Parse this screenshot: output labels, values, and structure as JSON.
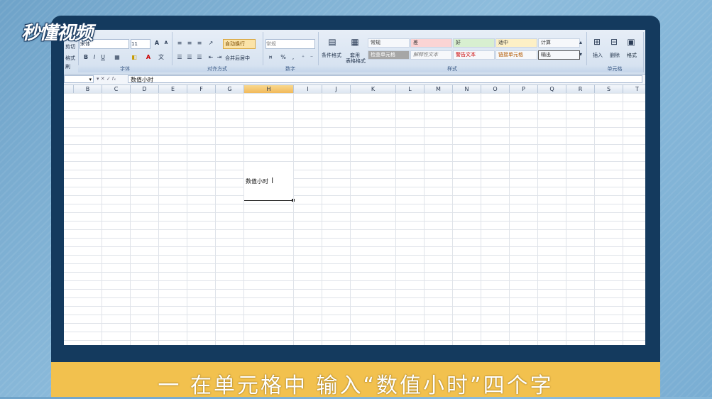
{
  "logo": "秒懂视频",
  "ribbon": {
    "clipboard": {
      "line1": "剪切",
      "line2": "格式刷"
    },
    "font": {
      "name": "宋体",
      "size": "11",
      "grow": "A",
      "shrink": "A",
      "bold": "B",
      "italic": "I",
      "underline": "U",
      "label": "字体"
    },
    "align": {
      "wrap": "自动换行",
      "merge": "合并后居中",
      "label": "对齐方式"
    },
    "number": {
      "format": "常规",
      "percent": "%",
      "comma": ",",
      "label": "数字"
    },
    "styles": {
      "cond": "条件格式",
      "table": "套用",
      "table2": "表格格式",
      "label": "样式",
      "cells": [
        {
          "text": "常规"
        },
        {
          "text": "差"
        },
        {
          "text": "好"
        },
        {
          "text": "适中"
        },
        {
          "text": "计算"
        },
        {
          "text": "检查单元格"
        },
        {
          "text": "解释性文本"
        },
        {
          "text": "警告文本"
        },
        {
          "text": "链接单元格"
        },
        {
          "text": "输出"
        }
      ]
    },
    "cells": {
      "insert": "插入",
      "delete": "删除",
      "format": "格式",
      "label": "单元格"
    }
  },
  "formula_bar": {
    "name_box": "",
    "content": "数值小时"
  },
  "columns": [
    "B",
    "C",
    "D",
    "E",
    "F",
    "G",
    "H",
    "I",
    "J",
    "K",
    "L",
    "M",
    "N",
    "O",
    "P",
    "Q",
    "R",
    "S",
    "T"
  ],
  "selected_column": "H",
  "active_cell": {
    "text": "数值小时"
  },
  "caption": "一  在单元格中  输入“数值小时”四个字",
  "colors": {
    "caption_bg": "#f2c14e",
    "monitor": "#143a5e",
    "selected_header": "#f1b95a"
  }
}
